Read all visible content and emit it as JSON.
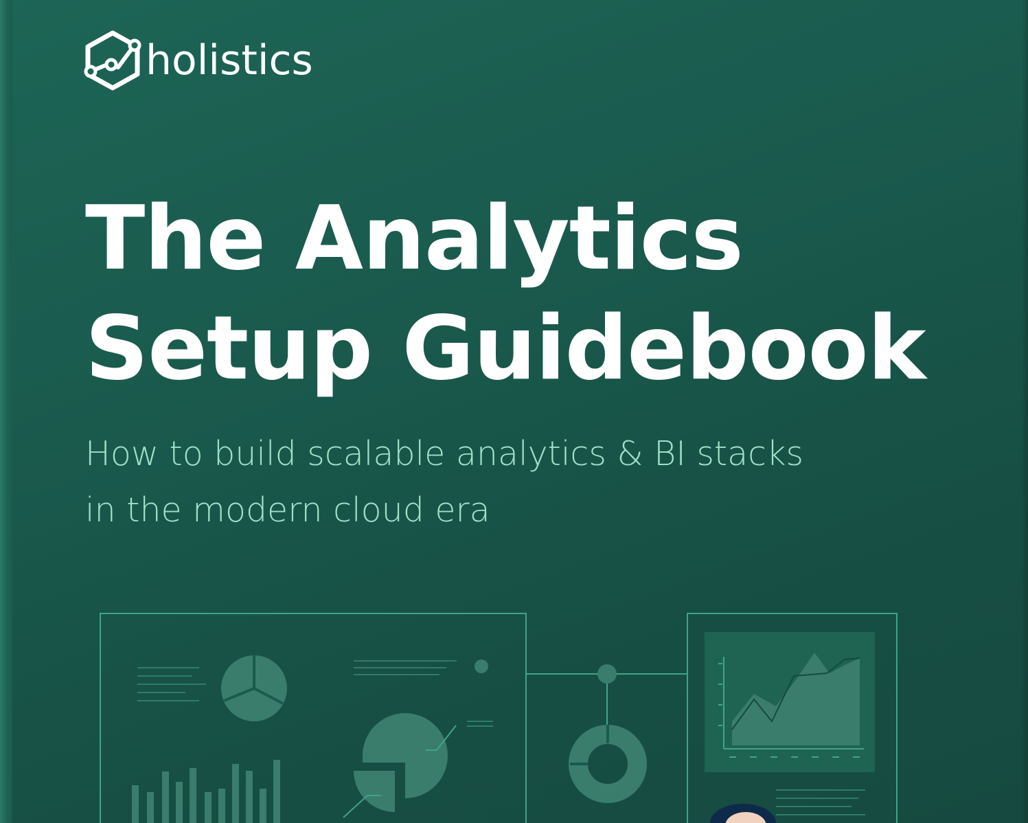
{
  "logo": {
    "wordmark": "holistics",
    "icon": "hexagon-graph-icon"
  },
  "cover": {
    "title_line1": "The Analytics",
    "title_line2": "Setup Guidebook",
    "subtitle_line1": "How to build scalable analytics & BI stacks",
    "subtitle_line2": "in the modern cloud era"
  },
  "colors": {
    "background": "#1a5b4e",
    "title": "#ffffff",
    "subtitle": "#9fe1c8",
    "illustration_lines": "#3fa587",
    "illustration_shapes": "#3a7d6d"
  }
}
